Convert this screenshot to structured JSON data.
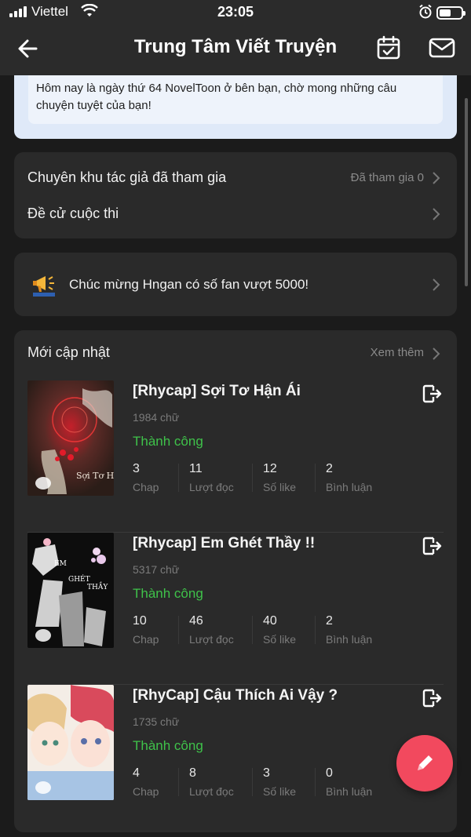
{
  "status_bar": {
    "carrier": "Viettel",
    "time": "23:05"
  },
  "nav": {
    "title": "Trung Tâm Viết Truyện"
  },
  "banner": {
    "text": "Hôm nay là ngày thứ 64 NovelToon ở bên bạn, chờ mong những câu chuyện tuyệt của bạn!"
  },
  "menu": {
    "author_zone_label": "Chuyên khu tác giả đã tham gia",
    "author_zone_value": "Đã tham gia 0",
    "contest_label": "Đề cử cuộc thi"
  },
  "announcement": {
    "text": "Chúc mừng Hngan  có số fan vượt 5000!"
  },
  "updates": {
    "heading": "Mới cập nhật",
    "see_more": "Xem thêm",
    "stories": [
      {
        "title": "[Rhycap] Sợi Tơ Hận Ái",
        "words": "1984 chữ",
        "status": "Thành công",
        "stats": [
          {
            "num": "3",
            "label": "Chap"
          },
          {
            "num": "11",
            "label": "Lượt đọc"
          },
          {
            "num": "12",
            "label": "Số like"
          },
          {
            "num": "2",
            "label": "Bình luận"
          }
        ]
      },
      {
        "title": "[Rhycap] Em Ghét Thầy !!",
        "words": "5317 chữ",
        "status": "Thành công",
        "stats": [
          {
            "num": "10",
            "label": "Chap"
          },
          {
            "num": "46",
            "label": "Lượt đọc"
          },
          {
            "num": "40",
            "label": "Số like"
          },
          {
            "num": "2",
            "label": "Bình luận"
          }
        ]
      },
      {
        "title": "[RhyCap] Cậu Thích Ai Vậy ?",
        "words": "1735 chữ",
        "status": "Thành công",
        "stats": [
          {
            "num": "4",
            "label": "Chap"
          },
          {
            "num": "8",
            "label": "Lượt đọc"
          },
          {
            "num": "3",
            "label": "Số like"
          },
          {
            "num": "0",
            "label": "Bình luận"
          }
        ]
      }
    ]
  },
  "cover_text": {
    "story1": "Sợi Tơ Hận Ái",
    "story2_line1": "EM",
    "story2_line2": "GHÉT",
    "story2_line3": "THẦY"
  },
  "colors": {
    "background": "#1b1b1b",
    "card": "#2a2a2a",
    "success": "#3fc24a",
    "fab": "#f2495e"
  },
  "icons": [
    "back-arrow-icon",
    "calendar-check-icon",
    "mail-icon",
    "chevron-right-icon",
    "megaphone-icon",
    "exit-icon",
    "pencil-icon",
    "comment-bubble-icon"
  ]
}
